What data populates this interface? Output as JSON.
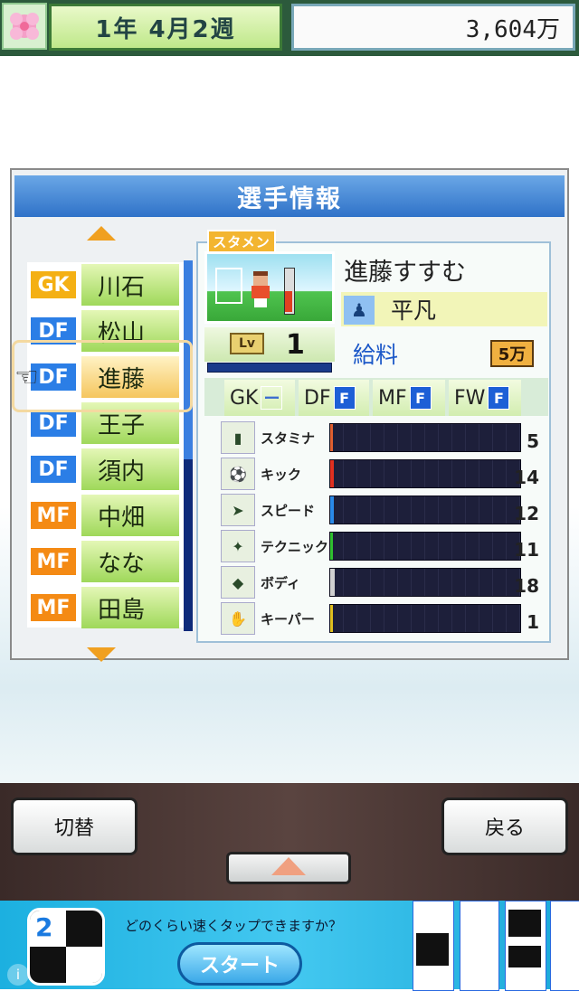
{
  "header": {
    "date": "1年 4月2週",
    "money": "3,604万"
  },
  "panel": {
    "title": "選手情報"
  },
  "roster": [
    {
      "pos": "GK",
      "name": "川石",
      "color": "#f4b014"
    },
    {
      "pos": "DF",
      "name": "松山",
      "color": "#2b7ee6"
    },
    {
      "pos": "DF",
      "name": "進藤",
      "color": "#2b7ee6",
      "selected": true
    },
    {
      "pos": "DF",
      "name": "王子",
      "color": "#2b7ee6"
    },
    {
      "pos": "DF",
      "name": "須内",
      "color": "#2b7ee6"
    },
    {
      "pos": "MF",
      "name": "中畑",
      "color": "#f48a14"
    },
    {
      "pos": "MF",
      "name": "なな",
      "color": "#f48a14"
    },
    {
      "pos": "MF",
      "name": "田島",
      "color": "#f48a14"
    }
  ],
  "player": {
    "badge": "スタメン",
    "name": "進藤すすむ",
    "trait": "平凡",
    "level_label": "Lv",
    "level": "1",
    "salary_label": "給料",
    "salary": "5万"
  },
  "aptitude": [
    {
      "pos": "GK",
      "mark": "ー"
    },
    {
      "pos": "DF",
      "mark": "F"
    },
    {
      "pos": "MF",
      "mark": "F"
    },
    {
      "pos": "FW",
      "mark": "F"
    }
  ],
  "stats": [
    {
      "label": "スタミナ",
      "value": 5,
      "color": "#e06030",
      "icon": "battery-icon"
    },
    {
      "label": "キック",
      "value": 14,
      "color": "#e03020",
      "icon": "kick-icon"
    },
    {
      "label": "スピード",
      "value": 12,
      "color": "#2a8ae8",
      "icon": "speed-icon"
    },
    {
      "label": "テクニック",
      "value": 11,
      "color": "#30c030",
      "icon": "technique-icon"
    },
    {
      "label": "ボディ",
      "value": 18,
      "color": "#d0d0d0",
      "icon": "body-icon"
    },
    {
      "label": "キーパー",
      "value": 1,
      "color": "#e0c020",
      "icon": "keeper-icon"
    }
  ],
  "buttons": {
    "switch": "切替",
    "back": "戻る"
  },
  "ad": {
    "app_number": "2",
    "text": "どのくらい速くタップできますか？",
    "start": "スタート"
  }
}
